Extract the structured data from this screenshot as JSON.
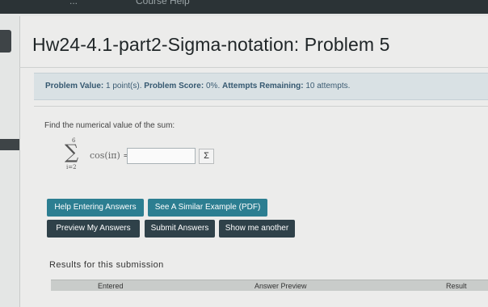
{
  "topbar": {
    "nav_left": "...",
    "nav_right": "Course Help"
  },
  "page_title": "Hw24-4.1-part2-Sigma-notation: Problem 5",
  "info": {
    "value_label": "Problem Value:",
    "value_text": "1 point(s).",
    "score_label": "Problem Score:",
    "score_text": "0%.",
    "attempts_label": "Attempts Remaining:",
    "attempts_text": "10 attempts."
  },
  "problem": {
    "prompt": "Find the numerical value of the sum:",
    "sum_upper": "6",
    "sum_symbol": "∑",
    "sum_lower": "i=2",
    "expression": "cos(iπ) =",
    "answer_value": "",
    "sigma_button": "Σ"
  },
  "buttons": {
    "help_entering": "Help Entering Answers",
    "similar_example": "See A Similar Example (PDF)",
    "preview": "Preview My Answers",
    "submit": "Submit Answers",
    "show_another": "Show me another"
  },
  "results": {
    "title": "Results for this submission",
    "columns": [
      "Entered",
      "Answer Preview",
      "Result"
    ]
  },
  "colors": {
    "teal_button": "#2c7e91",
    "dark_button": "#2f4149",
    "info_bg": "#d9e1e4"
  }
}
